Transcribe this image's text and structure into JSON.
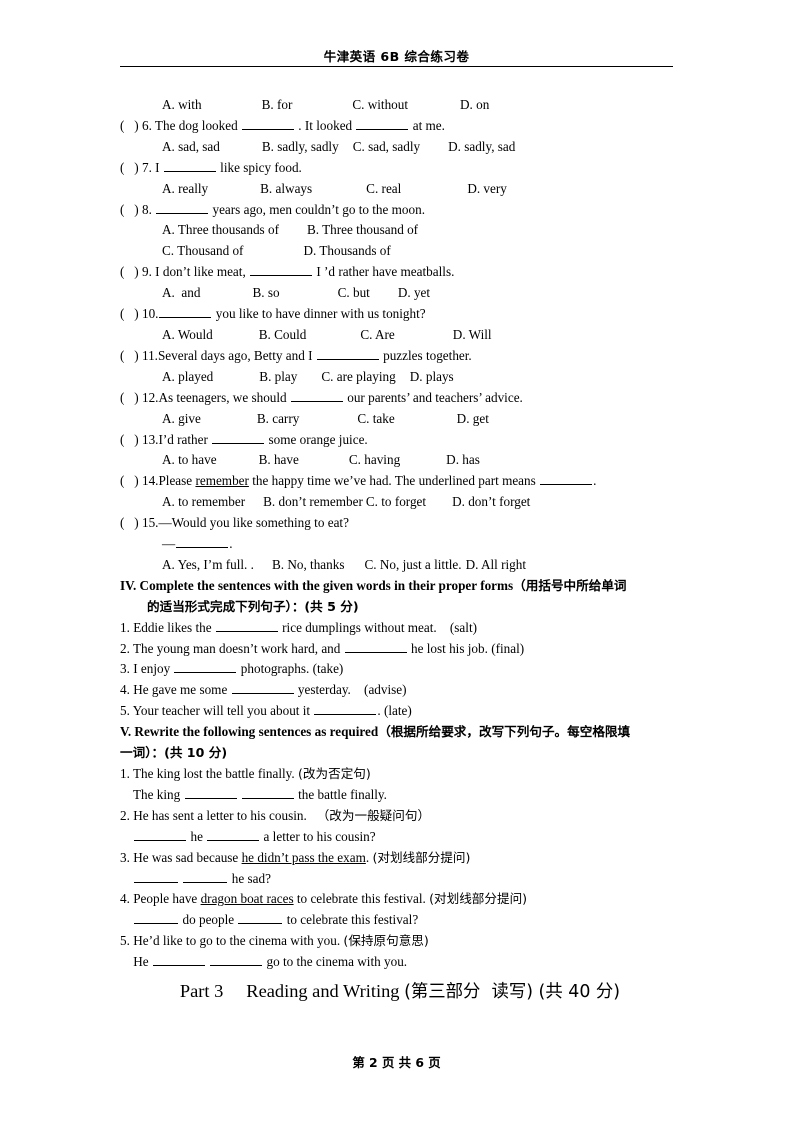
{
  "header": {
    "title": "牛津英语 6B 综合练习卷"
  },
  "mc_leftover_options": {
    "a": "A. with",
    "b": "B. for",
    "c": "C. without",
    "d": "D. on"
  },
  "questions": [
    {
      "num": "6",
      "stem_pre": "(   ) 6. The dog looked ",
      "stem_mid": " . It looked ",
      "stem_post": " at me.",
      "options": [
        "A. sad, sad",
        "B. sadly, sadly",
        "C. sad, sadly",
        "D. sadly, sad"
      ]
    },
    {
      "num": "7",
      "stem_pre": "(   ) 7. I ",
      "stem_post": " like spicy food.",
      "options": [
        "A. really",
        "B. always",
        "C. real",
        "D. very"
      ]
    },
    {
      "num": "8",
      "stem_pre": "(   ) 8. ",
      "stem_post": " years ago, men couldn’t go to the moon.",
      "options": [
        "A. Three thousands of",
        "B. Three thousand of",
        "C. Thousand of",
        "D. Thousands of"
      ]
    },
    {
      "num": "9",
      "stem_pre": "(   ) 9. I don’t like meat, ",
      "stem_post": " I ’d rather have meatballs.",
      "options": [
        "A.  and",
        "B. so",
        "C. but",
        "D. yet"
      ]
    },
    {
      "num": "10",
      "stem_pre": "(   ) 10.",
      "stem_post": " you like to have dinner with us tonight?",
      "options": [
        "A. Would",
        "B. Could",
        "C. Are",
        "D. Will"
      ]
    },
    {
      "num": "11",
      "stem_pre": "(   ) 11.Several days ago, Betty and I ",
      "stem_post": " puzzles together.",
      "options": [
        "A. played",
        "B. play",
        "C. are playing",
        "D. plays"
      ]
    },
    {
      "num": "12",
      "stem_pre": "(   ) 12.As teenagers, we should ",
      "stem_post": " our parents’ and teachers’ advice.",
      "options": [
        "A. give",
        "B. carry",
        "C. take",
        "D. get"
      ]
    },
    {
      "num": "13",
      "stem_pre": "(   ) 13.I’d rather ",
      "stem_post": " some orange juice.",
      "options": [
        "A. to have",
        "B. have",
        "C. having",
        "D. has"
      ]
    },
    {
      "num": "14",
      "stem_pre": "(   ) 14.Please ",
      "stem_underlined": "remember",
      "stem_mid2": " the happy time we’ve had. The underlined part means ",
      "stem_post": ".",
      "options": [
        "A. to remember",
        "B. don’t remember",
        "C. to forget",
        "D. don’t forget"
      ]
    },
    {
      "num": "15",
      "stem_pre": "(   ) 15.—Would you like something to eat?",
      "answer_dash": "—",
      "answer_post": ".",
      "options": [
        "A. Yes, I’m full. .",
        "B. No, thanks",
        "C. No, just a little.",
        "D. All right"
      ]
    }
  ],
  "section_iv": {
    "heading_en": "IV. Complete the sentences with the given words in their proper forms",
    "heading_cn_line1": "（用括号中所给单词",
    "heading_cn_line2": "的适当形式完成下列句子）：(共 5 分)",
    "items": [
      {
        "pre": "1. Eddie likes the ",
        "post": " rice dumplings without meat.    (salt)"
      },
      {
        "pre": "2. The young man doesn’t work hard, and ",
        "post": " he lost his job. (final)"
      },
      {
        "pre": "3. I enjoy ",
        "post": " photographs. (take)"
      },
      {
        "pre": "4. He gave me some ",
        "post": " yesterday.    (advise)"
      },
      {
        "pre": "5. Your teacher will tell you about it ",
        "post": ". (late)"
      }
    ]
  },
  "section_v": {
    "heading_en": "V. Rewrite the following sentences as required",
    "heading_cn_line1": "（根据所给要求，改写下列句子。每空格限填",
    "heading_cn_line2": "一词）：(共 10 分)",
    "items": [
      {
        "prompt_en": "1. The king lost the battle finally. ",
        "prompt_cn": "(改为否定句)",
        "answer_pre": "    The king ",
        "answer_mid": " ",
        "answer_post": " the battle finally."
      },
      {
        "prompt_en": "2. He has sent a letter to his cousin.   ",
        "prompt_cn": "（改为一般疑问句）",
        "answer_pre": "    ",
        "answer_mid": " he ",
        "answer_post": " a letter to his cousin?"
      },
      {
        "prompt_en_pre": "3. He was sad because ",
        "prompt_underlined": "he didn’t pass the exam",
        "prompt_en_post": ". ",
        "prompt_cn": "(对划线部分提问)",
        "answer_pre": "    ",
        "answer_mid": " ",
        "answer_post": " he sad?"
      },
      {
        "prompt_en_pre": "4. People have ",
        "prompt_underlined": "dragon boat races",
        "prompt_en_post": " to celebrate this festival. ",
        "prompt_cn": "(对划线部分提问)",
        "answer_pre": "    ",
        "answer_mid": " do people ",
        "answer_post": " to celebrate this festival?"
      },
      {
        "prompt_en": "5. He’d like to go to the cinema with you. ",
        "prompt_cn": "(保持原句意思)",
        "answer_pre": "    He ",
        "answer_mid": " ",
        "answer_post": " go to the cinema with you."
      }
    ]
  },
  "part3": {
    "label": "Part 3     Reading and Writing ",
    "cn": "(第三部分  读写) (共 40 分)"
  },
  "footer": {
    "text": "第 2 页  共 6 页"
  }
}
